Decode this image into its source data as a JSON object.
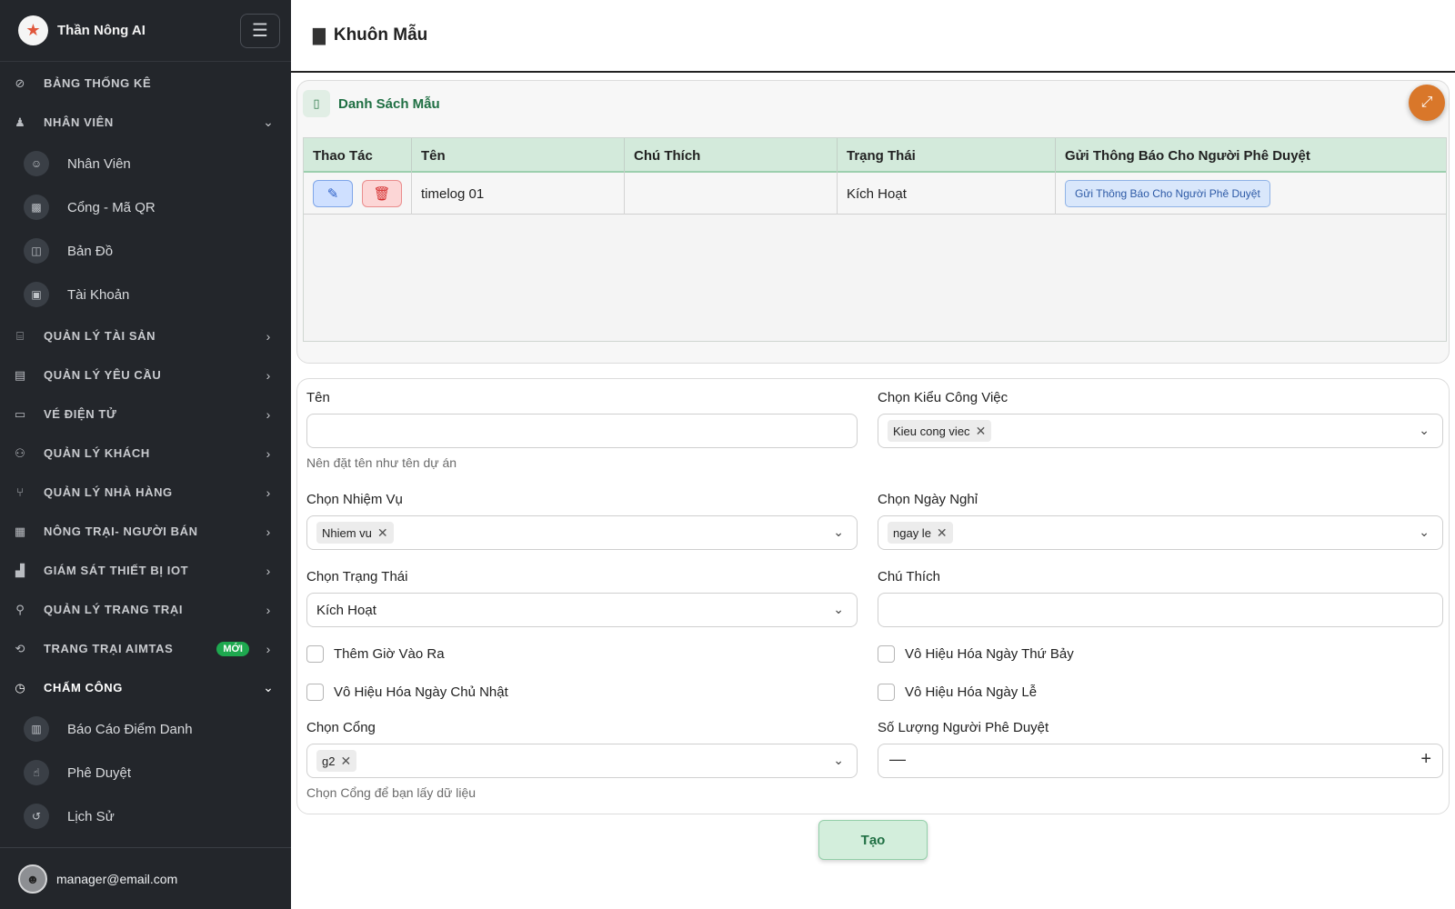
{
  "sidebar": {
    "brand": "Thần Nông AI",
    "logo_icon": "★",
    "menu_icon": "☰",
    "items": [
      {
        "label": "Bảng Thống Kê",
        "icon": "⊘",
        "chevron": ""
      },
      {
        "label": "Nhân Viên",
        "icon": "♟",
        "chevron": "⌄",
        "open": true
      },
      {
        "label": "Quản Lý Tài Sản",
        "icon": "⌸",
        "chevron": "›"
      },
      {
        "label": "Quản Lý Yêu Cầu",
        "icon": "▤",
        "chevron": "›"
      },
      {
        "label": "Vé Điện Tử",
        "icon": "▭",
        "chevron": "›"
      },
      {
        "label": "Quản Lý Khách",
        "icon": "⚇",
        "chevron": "›"
      },
      {
        "label": "Quản Lý Nhà Hàng",
        "icon": "⑂",
        "chevron": "›"
      },
      {
        "label": "Nông Trại- Người Bán",
        "icon": "▦",
        "chevron": "›"
      },
      {
        "label": "Giám Sát Thiết Bị IOT",
        "icon": "▟",
        "chevron": "›"
      },
      {
        "label": "Quản Lý Trang Trại",
        "icon": "⚲",
        "chevron": "›"
      },
      {
        "label": "Trang Trại AIMTAS",
        "icon": "⟲",
        "chevron": "›",
        "badge": "MỚI"
      },
      {
        "label": "Chấm Công",
        "icon": "◷",
        "chevron": "⌄",
        "open": true
      }
    ],
    "sub_employee": [
      {
        "label": "Nhân Viên",
        "icon": "☺"
      },
      {
        "label": "Cổng - Mã QR",
        "icon": "▩"
      },
      {
        "label": "Bản Đồ",
        "icon": "◫"
      },
      {
        "label": "Tài Khoản",
        "icon": "▣"
      }
    ],
    "sub_attendance": [
      {
        "label": "Báo Cáo Điểm Danh",
        "icon": "▥"
      },
      {
        "label": "Phê Duyệt",
        "icon": "☝"
      },
      {
        "label": "Lịch Sử",
        "icon": "↺"
      }
    ],
    "user_email": "manager@email.com",
    "avatar_icon": "☻"
  },
  "page": {
    "title": "Khuôn Mẫu",
    "title_icon": "▇"
  },
  "list_card": {
    "title": "Danh Sách Mẫu",
    "doc_icon": "▯",
    "expand_icon": "⤢",
    "columns": [
      "Thao Tác",
      "Tên",
      "Chú Thích",
      "Trạng Thái",
      "Gửi Thông Báo Cho Người Phê Duyệt"
    ],
    "rows": [
      {
        "name": "timelog 01",
        "note": "",
        "status": "Kích Hoạt",
        "notify_label": "Gửi Thông Báo Cho Người Phê Duyệt"
      }
    ],
    "edit_icon": "✎",
    "delete_icon": "🗑"
  },
  "form": {
    "name_label": "Tên",
    "name_value": "",
    "name_hint": "Nên đặt tên như tên dự án",
    "work_type_label": "Chọn Kiểu Công Việc",
    "work_type_tag": "Kieu cong viec",
    "task_label": "Chọn Nhiệm Vụ",
    "task_tag": "Nhiem vu",
    "holiday_label": "Chọn Ngày Nghỉ",
    "holiday_tag": "ngay le",
    "status_label": "Chọn Trạng Thái",
    "status_value": "Kích Hoạt",
    "note_label": "Chú Thích",
    "note_value": "",
    "cb_in_out": "Thêm Giờ Vào Ra",
    "cb_saturday": "Vô Hiệu Hóa Ngày Thứ Bảy",
    "cb_sunday": "Vô Hiệu Hóa Ngày Chủ Nhật",
    "cb_holiday": "Vô Hiệu Hóa Ngày Lễ",
    "gate_label": "Chọn Cổng",
    "gate_tag": "g2",
    "gate_hint": "Chọn Cổng để bạn lấy dữ liệu",
    "approver_label": "Số Lượng Người Phê Duyệt",
    "approver_value": "",
    "tag_remove": "✕",
    "chevron": "⌄",
    "minus": "—",
    "plus": "+",
    "submit_label": "Tạo"
  },
  "colors": {
    "sidebar_bg": "#23262b",
    "accent_green": "#1f6f43",
    "table_header_bg": "#d3eadb",
    "badge_green": "#1ea84f",
    "expand_orange": "#d9772a"
  }
}
